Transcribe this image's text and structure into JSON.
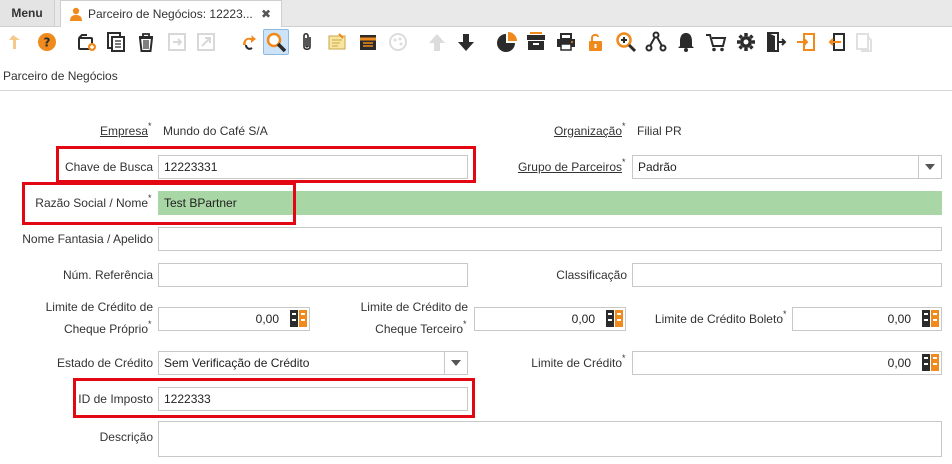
{
  "tabs": {
    "menu_label": "Menu",
    "active_title": "Parceiro de Negócios: 12223...",
    "close_symbol": "✖"
  },
  "toolbar": {
    "icons": [
      "undo-icon",
      "help-icon",
      "new-record-icon",
      "copy-record-icon",
      "delete-icon",
      "save-icon",
      "save-new-icon",
      "refresh-icon",
      "find-icon",
      "attachment-icon",
      "note-icon",
      "product-info-icon",
      "chat-icon",
      "previous-icon",
      "next-icon",
      "chart-icon",
      "archive-icon",
      "print-icon",
      "lock-icon",
      "zoom-across-icon",
      "workflow-icon",
      "alert-icon",
      "request-icon",
      "settings-icon",
      "exit-icon",
      "export-icon",
      "import-icon"
    ]
  },
  "header": {
    "section_title": "Parceiro de Negócios"
  },
  "form": {
    "empresa_label": "Empresa",
    "empresa_value": "Mundo do Café S/A",
    "organizacao_label": "Organização",
    "organizacao_value": "Filial PR",
    "chave_busca_label": "Chave de Busca",
    "chave_busca_value": "12223331",
    "grupo_parceiros_label": "Grupo de Parceiros",
    "grupo_parceiros_value": "Padrão",
    "razao_social_label": "Razão Social / Nome",
    "razao_social_value": "Test BPartner",
    "nome_fantasia_label": "Nome Fantasia / Apelido",
    "nome_fantasia_value": "",
    "num_referencia_label": "Núm. Referência",
    "num_referencia_value": "",
    "classificacao_label": "Classificação",
    "classificacao_value": "",
    "limite_cheque_proprio_label_1": "Limite de Crédito de",
    "limite_cheque_proprio_label_2": "Cheque Próprio",
    "limite_cheque_proprio_value": "0,00",
    "limite_cheque_terceiro_label_1": "Limite de Crédito de",
    "limite_cheque_terceiro_label_2": "Cheque Terceiro",
    "limite_cheque_terceiro_value": "0,00",
    "limite_boleto_label": "Limite de Crédito Boleto",
    "limite_boleto_value": "0,00",
    "estado_credito_label": "Estado de Crédito",
    "estado_credito_value": "Sem Verificação de Crédito",
    "limite_credito_label": "Limite de Crédito",
    "limite_credito_value": "0,00",
    "id_imposto_label": "ID de Imposto",
    "id_imposto_value": "1222333",
    "descricao_label": "Descrição",
    "required_mark": "*"
  },
  "colors": {
    "highlight": "#e30613",
    "mandatory_field_bg": "#a8d6a4",
    "icon_orange": "#f08a1c",
    "icon_dark": "#2b2b2b"
  }
}
